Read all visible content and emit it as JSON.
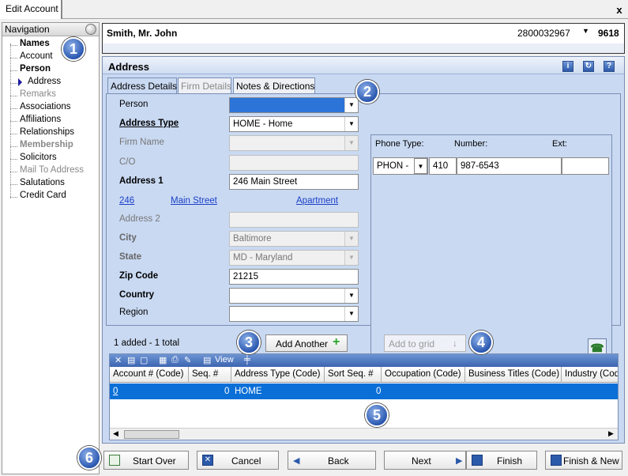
{
  "window": {
    "title": "Edit Account",
    "close_label": "x"
  },
  "navigation": {
    "title": "Navigation",
    "items": [
      {
        "label": "Names",
        "style": "bold"
      },
      {
        "label": "Account",
        "style": "normal"
      },
      {
        "label": "Person",
        "style": "bold"
      },
      {
        "label": "Address",
        "style": "current"
      },
      {
        "label": "Remarks",
        "style": "gray"
      },
      {
        "label": "Associations",
        "style": "normal"
      },
      {
        "label": "Affiliations",
        "style": "normal"
      },
      {
        "label": "Relationships",
        "style": "normal"
      },
      {
        "label": "Membership",
        "style": "gray-bold"
      },
      {
        "label": "Solicitors",
        "style": "normal"
      },
      {
        "label": "Mail To Address",
        "style": "gray"
      },
      {
        "label": "Salutations",
        "style": "normal"
      },
      {
        "label": "Credit Card",
        "style": "normal"
      }
    ]
  },
  "header": {
    "name": "Smith,   Mr. John",
    "account_number": "2800032967",
    "id": "9618"
  },
  "address_panel": {
    "title": "Address",
    "tabs": [
      "Address Details",
      "Firm Details",
      "Notes & Directions"
    ],
    "fields": {
      "person": {
        "label": "Person",
        "value": ""
      },
      "address_type": {
        "label": "Address Type",
        "value": "HOME - Home"
      },
      "firm_name": {
        "label": "Firm Name",
        "value": ""
      },
      "co": {
        "label": "C/O",
        "value": ""
      },
      "address1": {
        "label": "Address 1",
        "value": "246 Main Street"
      },
      "address2": {
        "label": "Address 2",
        "value": ""
      },
      "city": {
        "label": "City",
        "value": "Baltimore"
      },
      "state": {
        "label": "State",
        "value": "MD - Maryland"
      },
      "zip": {
        "label": "Zip Code",
        "value": "21215"
      },
      "country": {
        "label": "Country",
        "value": ""
      },
      "region": {
        "label": "Region",
        "value": ""
      }
    },
    "parsed": {
      "number": "246",
      "street": "Main Street",
      "unit": "Apartment"
    },
    "phone": {
      "type_label": "Phone Type:",
      "number_label": "Number:",
      "ext_label": "Ext:",
      "type_value": "PHON -",
      "area": "410",
      "number": "987-6543",
      "ext": ""
    },
    "summary": "1 added - 1 total",
    "add_another": "Add Another",
    "add_to_grid": "Add to grid",
    "grid": {
      "view_label": "View",
      "columns": [
        "Account # (Code)",
        "Seq. #",
        "Address Type (Code)",
        "Sort Seq. #",
        "Occupation (Code)",
        "Business Titles (Code)",
        "Industry (Code)"
      ],
      "row": {
        "account": "0",
        "seq": "0",
        "type": "HOME",
        "sort": "0"
      }
    }
  },
  "buttons": {
    "start_over": "Start Over",
    "cancel": "Cancel",
    "back": "Back",
    "next": "Next",
    "finish": "Finish",
    "finish_new": "Finish & New"
  },
  "callouts": [
    "1",
    "2",
    "3",
    "4",
    "5",
    "6"
  ]
}
